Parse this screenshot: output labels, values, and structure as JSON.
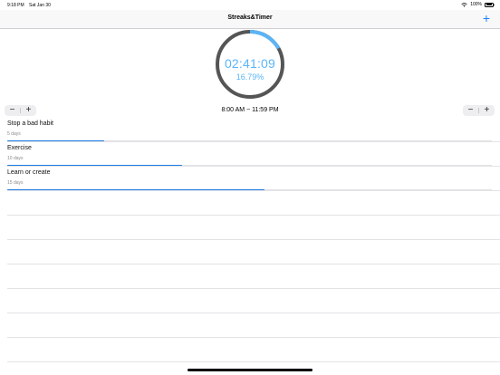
{
  "status_bar": {
    "time": "9:18 PM",
    "date": "Sat Jan 30",
    "battery": "100%"
  },
  "nav": {
    "title": "Streaks&Timer",
    "add_label": "+"
  },
  "timer": {
    "time": "02:41:09",
    "percent": "16.79%",
    "progress": 0.1679,
    "colors": {
      "progress": "#5ab5f8",
      "track": "#555555"
    }
  },
  "schedule": {
    "range": "8:00 AM ~ 11:59 PM",
    "minus_label": "−",
    "plus_label": "+"
  },
  "habits": [
    {
      "name": "Stop a bad habit",
      "days": "5 days",
      "progress": 0.2
    },
    {
      "name": "Exercise",
      "days": "10 days",
      "progress": 0.36
    },
    {
      "name": "Learn or create",
      "days": "15 days",
      "progress": 0.53
    }
  ],
  "colors": {
    "accent": "#1a82fb",
    "progress_fill": "#1a7be5"
  }
}
